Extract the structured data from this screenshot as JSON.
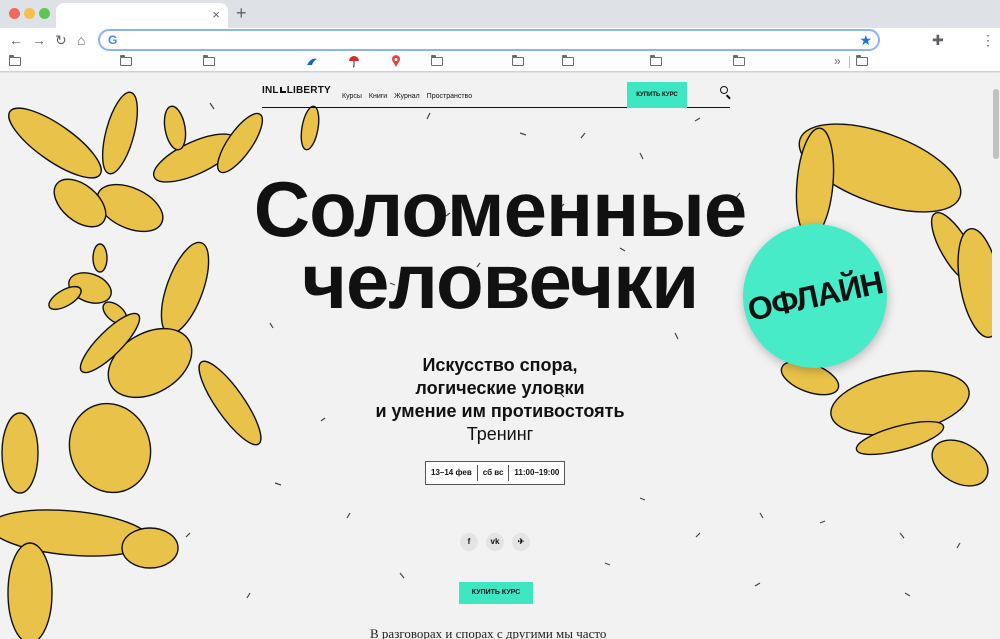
{
  "browser": {
    "tab_close": "×",
    "new_tab": "+",
    "back": "←",
    "forward": "→",
    "reload": "↻",
    "home": "⌂",
    "omnibox_logo": "G",
    "star": "★",
    "extensions": "✚",
    "menu": "⋮",
    "bookmarks_more": "»"
  },
  "site": {
    "logo": [
      "INL",
      "LIBERTY"
    ],
    "menu": [
      "Курсы",
      "Книги",
      "Журнал",
      "Пространство"
    ],
    "buy_course_top": "КУПИТЬ КУРС"
  },
  "hero": {
    "title_line1": "Соломенные",
    "title_line2": "человечки",
    "badge": "ОФЛАЙН",
    "subtitle_line1": "Искусство спора,",
    "subtitle_line2": "логические уловки",
    "subtitle_line3": "и умение им противостоять",
    "format": "Тренинг",
    "dates": "13–14 фев",
    "days": "сб вс",
    "time": "11:00–19:00",
    "social": [
      "f",
      "vk",
      "✈"
    ],
    "buy_course": "КУПИТЬ КУРС",
    "lead": "В разговорах и спорах с другими мы часто"
  },
  "colors": {
    "accent": "#3ee6c1",
    "straw": "#e9c24a",
    "background": "#f2f2f2",
    "text": "#111111"
  }
}
